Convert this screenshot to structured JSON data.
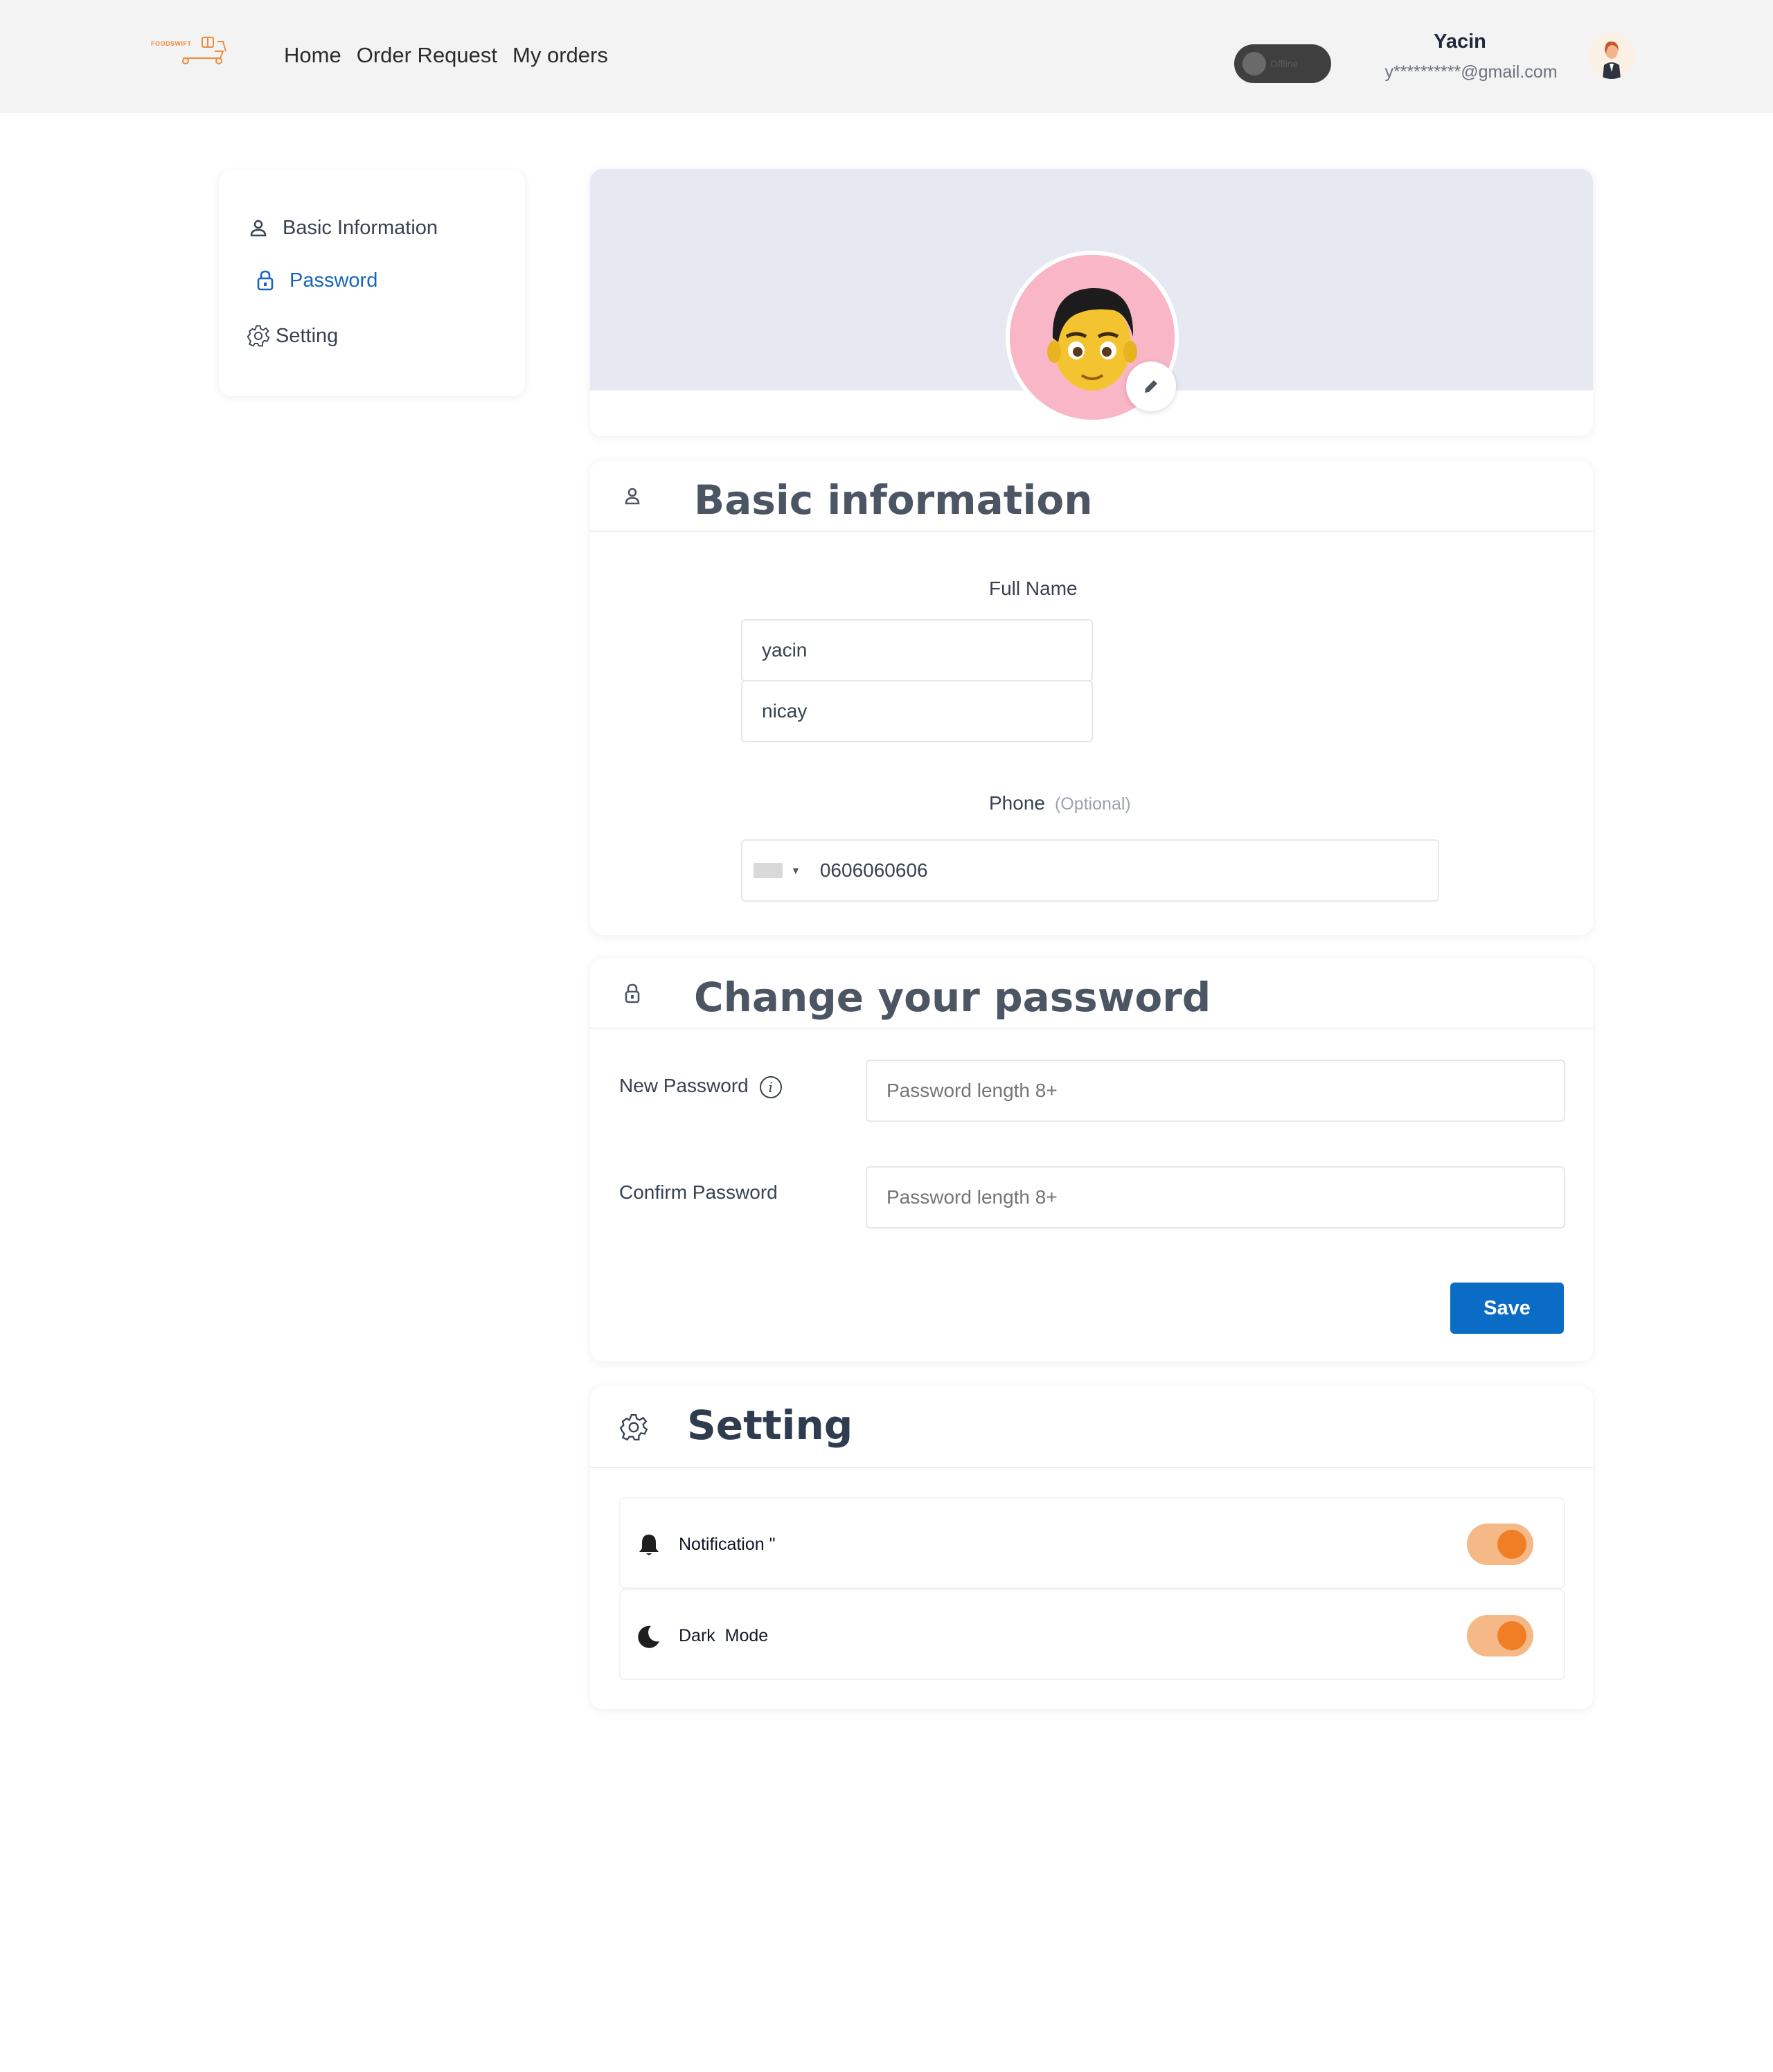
{
  "header": {
    "logo_text": "FOODSWIFT",
    "nav": [
      "Home",
      "Order Request",
      "My orders"
    ],
    "status_toggle": {
      "label": "Offline",
      "on": false
    },
    "user": {
      "name": "Yacin",
      "email": "y**********@gmail.com"
    }
  },
  "sidebar": {
    "items": [
      {
        "label": "Basic Information",
        "icon": "user-icon",
        "active": false
      },
      {
        "label": "Password",
        "icon": "lock-icon",
        "active": true
      },
      {
        "label": "Setting",
        "icon": "gear-icon",
        "active": false
      }
    ]
  },
  "basic": {
    "title": "Basic information",
    "full_name_label": "Full Name",
    "first_name": "yacin",
    "last_name": "nicay",
    "phone_label": "Phone",
    "phone_optional": "(Optional)",
    "phone_value": "0606060606"
  },
  "password": {
    "title": "Change your password",
    "new_label": "New Password",
    "confirm_label": "Confirm Password",
    "new_placeholder": "Password length 8+",
    "confirm_placeholder": "Password length 8+",
    "save_label": "Save"
  },
  "settings": {
    "title": "Setting",
    "rows": [
      {
        "label": "Notification \"",
        "icon": "bell-icon",
        "on": true
      },
      {
        "label": "Dark  Mode",
        "icon": "moon-icon",
        "on": true
      }
    ]
  },
  "colors": {
    "accent": "#0a6cc4",
    "toggle_track": "#f5b887",
    "toggle_knob": "#f07e25",
    "cover_bg": "#e6e9f2",
    "avatar_bg": "#f9b6c6"
  }
}
